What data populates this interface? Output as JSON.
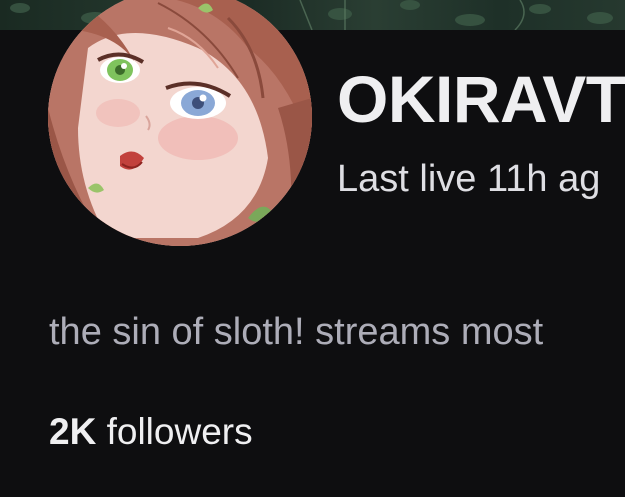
{
  "channel": {
    "name": "OKIRAVT",
    "last_live": "Last live 11h ag",
    "bio": "the sin of sloth! streams most",
    "followers_count": "2K",
    "followers_label": " followers"
  },
  "icons": {
    "avatar": "channel-avatar-illustration"
  },
  "colors": {
    "background": "#0e0e10",
    "name_text": "#efeff1",
    "bio_text": "#adadb8"
  }
}
